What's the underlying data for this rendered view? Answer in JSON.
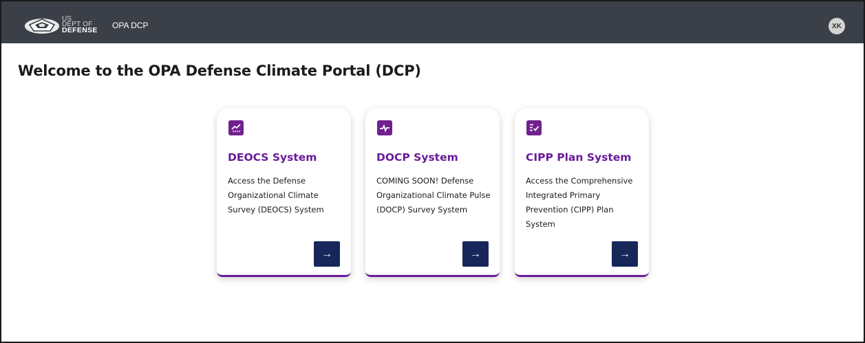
{
  "header": {
    "logo_line1": "US",
    "logo_line2": "DEPT OF",
    "logo_line3": "DEFENSE",
    "app_title": "OPA DCP",
    "avatar_initials": "XK"
  },
  "main": {
    "welcome": "Welcome to the OPA Defense Climate Portal (DCP)",
    "cards": [
      {
        "icon": "chart-trend-icon",
        "title": "DEOCS System",
        "description": "Access the Defense Organizational Climate Survey (DEOCS) System",
        "button_icon": "arrow-right-icon"
      },
      {
        "icon": "pulse-icon",
        "title": "DOCP System",
        "description": "COMING SOON! Defense Organizational Climate Pulse (DOCP) Survey System",
        "button_icon": "arrow-right-icon"
      },
      {
        "icon": "checklist-icon",
        "title": "CIPP Plan System",
        "description": "Access the Comprehensive Integrated Primary Prevention (CIPP) Plan System",
        "button_icon": "arrow-right-icon"
      }
    ]
  },
  "colors": {
    "header_bg": "#3b3f47",
    "accent_purple": "#6a1b9a",
    "button_navy": "#17275a"
  }
}
